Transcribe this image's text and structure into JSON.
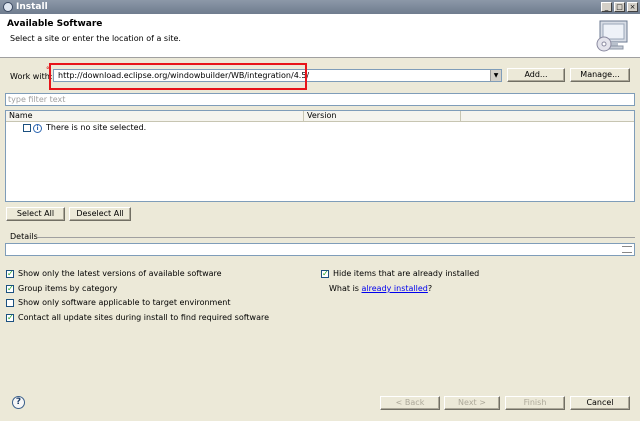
{
  "window": {
    "title": "Install",
    "controls": {
      "minimize": "_",
      "maximize": "□",
      "close": "×"
    }
  },
  "banner": {
    "heading": "Available Software",
    "subtitle": "Select a site or enter the location of a site."
  },
  "work_with": {
    "label": "Work with:",
    "url": "http://download.eclipse.org/windowbuilder/WB/integration/4.5/",
    "add_label": "Add...",
    "manage_label": "Manage..."
  },
  "filter": {
    "placeholder": "type filter text"
  },
  "tree": {
    "columns": [
      "Name",
      "Version"
    ],
    "message": "There is no site selected.",
    "info_icon": "i"
  },
  "selection": {
    "select_all": "Select All",
    "deselect_all": "Deselect All"
  },
  "details": {
    "label": "Details"
  },
  "options": {
    "latest_versions": {
      "label": "Show only the latest versions of available software",
      "checked": true
    },
    "group_by_category": {
      "label": "Group items by category",
      "checked": true
    },
    "target_env": {
      "label": "Show only software applicable to target environment",
      "checked": false
    },
    "contact_sites": {
      "label": "Contact all update sites during install to find required software",
      "checked": true
    },
    "hide_installed": {
      "label": "Hide items that are already installed",
      "checked": true
    },
    "what_is_prefix": "What is ",
    "what_is_link": "already installed",
    "what_is_suffix": "?"
  },
  "footer": {
    "help": "?",
    "back": "< Back",
    "next": "Next >",
    "finish": "Finish",
    "cancel": "Cancel"
  },
  "colors": {
    "highlight": "#e8141a",
    "link": "#0000ee"
  }
}
